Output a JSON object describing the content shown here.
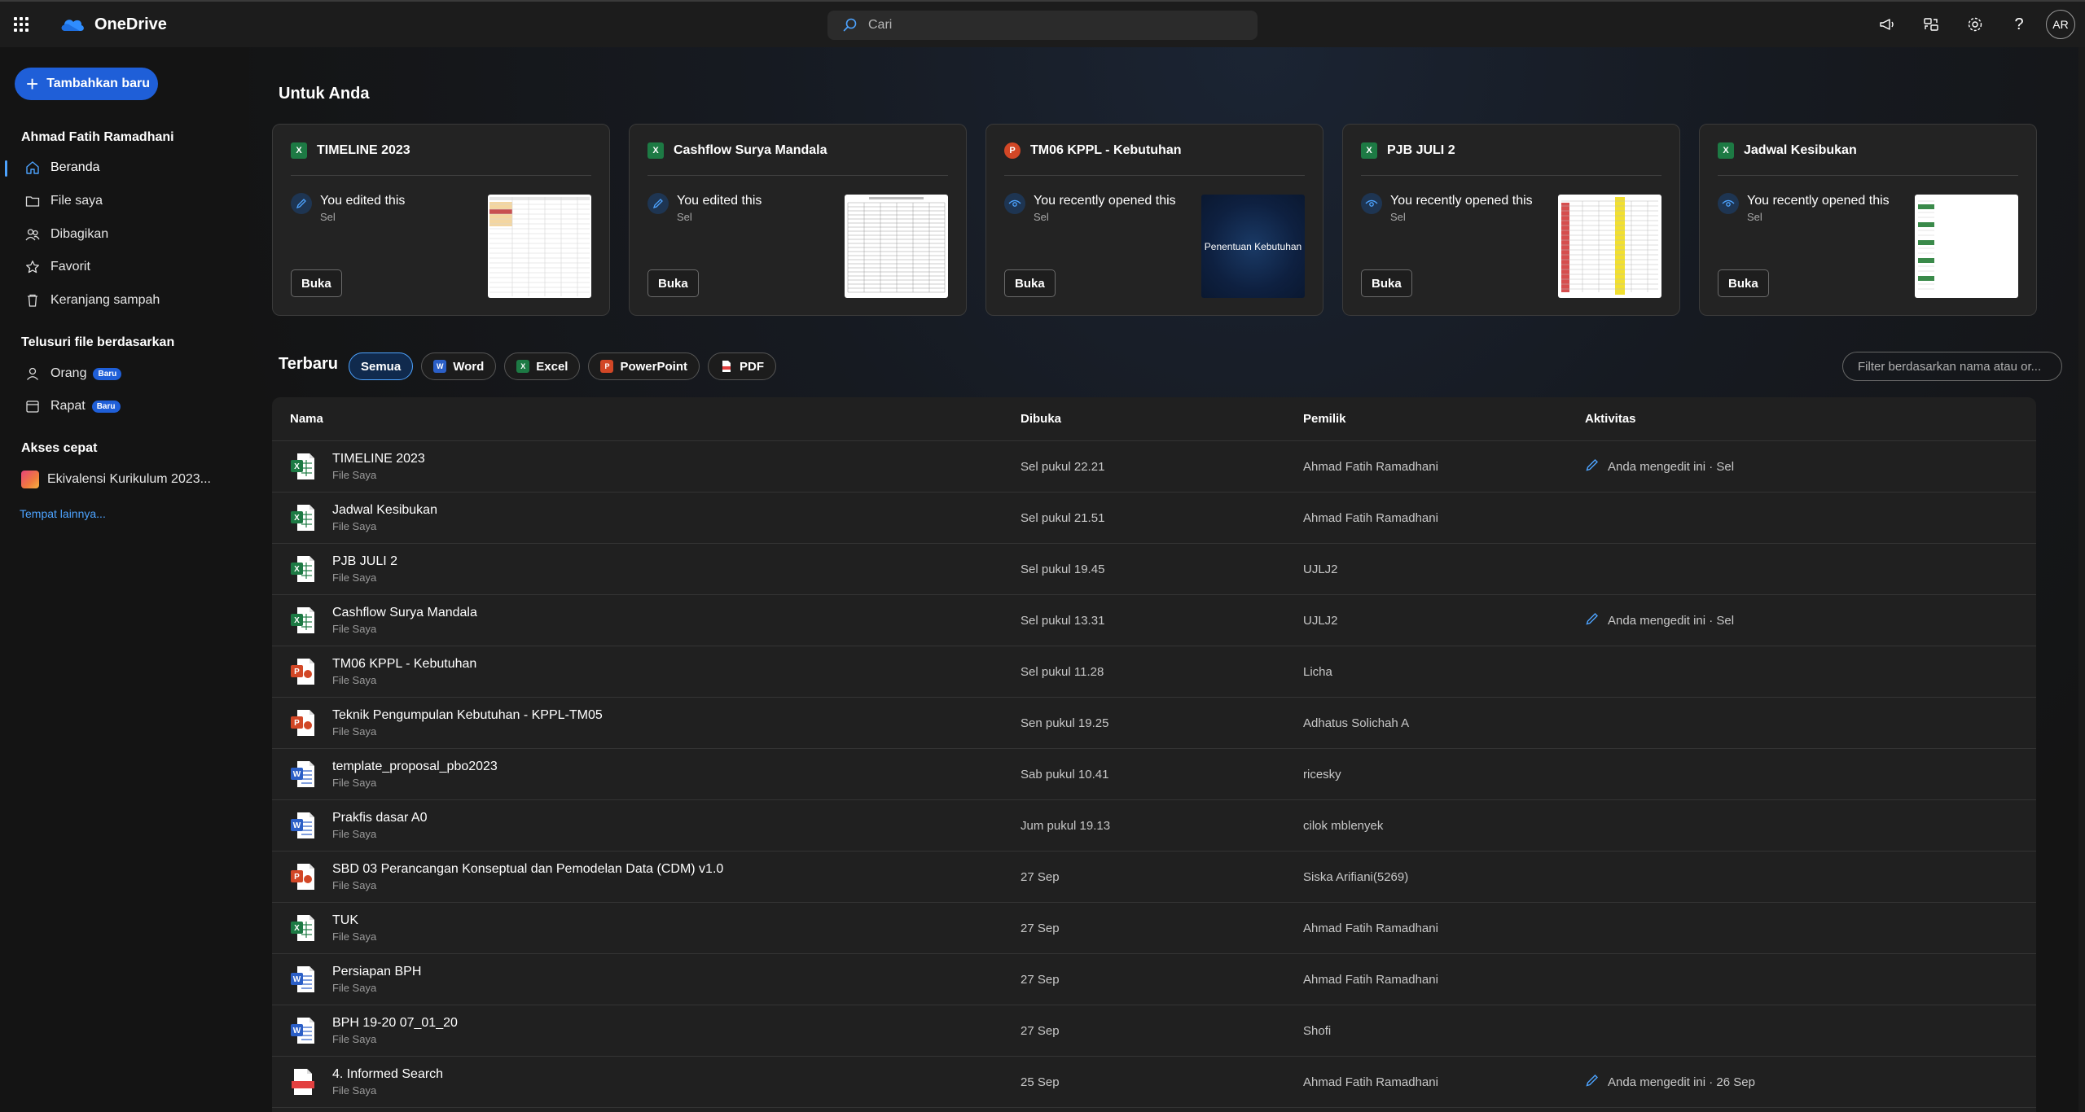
{
  "app": {
    "name": "OneDrive"
  },
  "search": {
    "placeholder": "Cari"
  },
  "header_icons": [
    "megaphone-icon",
    "share-icon",
    "gear-icon",
    "help-icon"
  ],
  "user": {
    "initials": "AR"
  },
  "sidebar": {
    "add_label": "Tambahkan baru",
    "account_name": "Ahmad Fatih Ramadhani",
    "items": [
      {
        "label": "Beranda",
        "icon": "home-icon",
        "active": true
      },
      {
        "label": "File saya",
        "icon": "folder-icon"
      },
      {
        "label": "Dibagikan",
        "icon": "people-icon"
      },
      {
        "label": "Favorit",
        "icon": "star-icon"
      },
      {
        "label": "Keranjang sampah",
        "icon": "trash-icon"
      }
    ],
    "browse_title": "Telusuri file berdasarkan",
    "browse_items": [
      {
        "label": "Orang",
        "badge": "Baru",
        "icon": "person-icon"
      },
      {
        "label": "Rapat",
        "badge": "Baru",
        "icon": "calendar-icon"
      }
    ],
    "quick_title": "Akses cepat",
    "quick_items": [
      {
        "label": "Ekivalensi Kurikulum 2023..."
      }
    ],
    "more_link": "Tempat lainnya..."
  },
  "for_you": {
    "title": "Untuk Anda",
    "open_label": "Buka",
    "cards": [
      {
        "title": "TIMELINE 2023",
        "type": "X",
        "activity": "You edited this",
        "when": "Sel"
      },
      {
        "title": "Cashflow Surya Mandala",
        "type": "X",
        "activity": "You edited this",
        "when": "Sel"
      },
      {
        "title": "TM06 KPPL - Kebutuhan",
        "type": "P",
        "activity": "You recently opened this",
        "when": "Sel",
        "thumb_text": "Penentuan Kebutuhan"
      },
      {
        "title": "PJB JULI 2",
        "type": "X",
        "activity": "You recently opened this",
        "when": "Sel"
      },
      {
        "title": "Jadwal Kesibukan",
        "type": "X",
        "activity": "You recently opened this",
        "when": "Sel"
      }
    ]
  },
  "recent": {
    "title": "Terbaru",
    "filters": [
      "Semua",
      "Word",
      "Excel",
      "PowerPoint",
      "PDF"
    ],
    "filter_placeholder": "Filter berdasarkan nama atau or...",
    "columns": {
      "name": "Nama",
      "opened": "Dibuka",
      "owner": "Pemilik",
      "activity": "Aktivitas"
    },
    "rows": [
      {
        "name": "TIMELINE 2023",
        "location": "File Saya",
        "opened": "Sel pukul 22.21",
        "owner": "Ahmad Fatih Ramadhani",
        "activity": "Anda mengedit ini · Sel",
        "type": "excel"
      },
      {
        "name": "Jadwal Kesibukan",
        "location": "File Saya",
        "opened": "Sel pukul 21.51",
        "owner": "Ahmad Fatih Ramadhani",
        "activity": "",
        "type": "excel"
      },
      {
        "name": "PJB JULI 2",
        "location": "File Saya",
        "opened": "Sel pukul 19.45",
        "owner": "UJLJ2",
        "activity": "",
        "type": "excel"
      },
      {
        "name": "Cashflow Surya Mandala",
        "location": "File Saya",
        "opened": "Sel pukul 13.31",
        "owner": "UJLJ2",
        "activity": "Anda mengedit ini · Sel",
        "type": "excel"
      },
      {
        "name": "TM06 KPPL - Kebutuhan",
        "location": "File Saya",
        "opened": "Sel pukul 11.28",
        "owner": "Licha",
        "activity": "",
        "type": "ppt"
      },
      {
        "name": "Teknik Pengumpulan Kebutuhan - KPPL-TM05",
        "location": "File Saya",
        "opened": "Sen pukul 19.25",
        "owner": "Adhatus Solichah A",
        "activity": "",
        "type": "ppt"
      },
      {
        "name": "template_proposal_pbo2023",
        "location": "File Saya",
        "opened": "Sab pukul 10.41",
        "owner": "ricesky",
        "activity": "",
        "type": "word"
      },
      {
        "name": "Prakfis dasar A0",
        "location": "File Saya",
        "opened": "Jum pukul 19.13",
        "owner": "cilok mblenyek",
        "activity": "",
        "type": "word"
      },
      {
        "name": "SBD 03 Perancangan Konseptual dan Pemodelan Data (CDM) v1.0",
        "location": "File Saya",
        "opened": "27 Sep",
        "owner": "Siska Arifiani(5269)",
        "activity": "",
        "type": "ppt"
      },
      {
        "name": "TUK",
        "location": "File Saya",
        "opened": "27 Sep",
        "owner": "Ahmad Fatih Ramadhani",
        "activity": "",
        "type": "excel"
      },
      {
        "name": "Persiapan BPH",
        "location": "File Saya",
        "opened": "27 Sep",
        "owner": "Ahmad Fatih Ramadhani",
        "activity": "",
        "type": "word"
      },
      {
        "name": "BPH 19-20 07_01_20",
        "location": "File Saya",
        "opened": "27 Sep",
        "owner": "Shofi",
        "activity": "",
        "type": "word"
      },
      {
        "name": "4. Informed Search",
        "location": "File Saya",
        "opened": "25 Sep",
        "owner": "Ahmad Fatih Ramadhani",
        "activity": "Anda mengedit ini · 26 Sep",
        "type": "pdf"
      }
    ]
  },
  "colors": {
    "accent": "#1f5fd8",
    "link": "#4da3ff",
    "excel": "#1d7a44",
    "word": "#2b5fc7",
    "ppt": "#d24726",
    "pdf": "#e34040"
  }
}
